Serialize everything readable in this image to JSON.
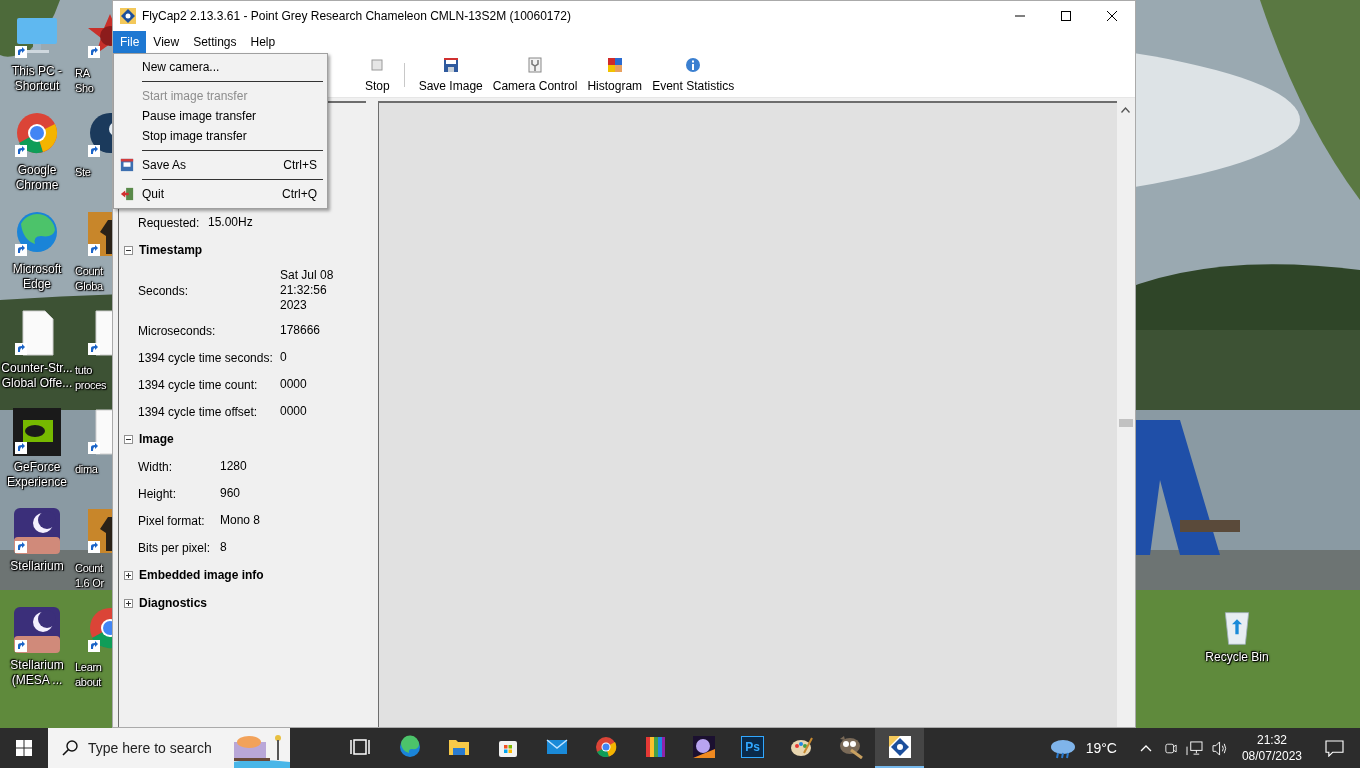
{
  "desktop": {
    "icons": [
      {
        "label": [
          "This PC -",
          "Shortcut"
        ]
      },
      {
        "label": [
          "Google",
          "Chrome"
        ]
      },
      {
        "label": [
          "Microsoft",
          "Edge"
        ]
      },
      {
        "label": [
          "Counter-Str...",
          "Global Offe..."
        ]
      },
      {
        "label": [
          "GeForce",
          "Experience"
        ]
      },
      {
        "label": [
          "Stellarium"
        ]
      },
      {
        "label": [
          "Stellarium",
          "(MESA ..."
        ]
      }
    ],
    "icons_column_2": [
      {
        "label": [
          "RA",
          "Sho"
        ]
      },
      {
        "label": [
          "Ste"
        ]
      },
      {
        "label": [
          "Count",
          "Globa"
        ]
      },
      {
        "label": [
          "tuto",
          "proces"
        ]
      },
      {
        "label": [
          "dima"
        ]
      },
      {
        "label": [
          "Count",
          "1.6 Or"
        ]
      },
      {
        "label": [
          "Learn",
          "about"
        ]
      }
    ],
    "recycle_bin": {
      "label": "Recycle Bin"
    }
  },
  "window": {
    "title": "FlyCap2 2.13.3.61 - Point Grey Research Chameleon CMLN-13S2M (10060172)",
    "menu": [
      {
        "label": "File",
        "selected": true
      },
      {
        "label": "View",
        "selected": false
      },
      {
        "label": "Settings",
        "selected": false
      },
      {
        "label": "Help",
        "selected": false
      }
    ],
    "file_menu": [
      {
        "kind": "item",
        "label": "New camera...",
        "disabled": false
      },
      {
        "kind": "separator"
      },
      {
        "kind": "item",
        "label": "Start image transfer",
        "disabled": true
      },
      {
        "kind": "item",
        "label": "Pause image transfer",
        "disabled": false
      },
      {
        "kind": "item",
        "label": "Stop image transfer",
        "disabled": false
      },
      {
        "kind": "separator"
      },
      {
        "kind": "item",
        "label": "Save As",
        "shortcut": "Ctrl+S",
        "disabled": false
      },
      {
        "kind": "separator"
      },
      {
        "kind": "item",
        "label": "Quit",
        "shortcut": "Ctrl+Q",
        "disabled": false
      }
    ],
    "toolbar": [
      {
        "kind": "button",
        "label": "Stop"
      },
      {
        "kind": "separator"
      },
      {
        "kind": "button",
        "label": "Save Image"
      },
      {
        "kind": "button",
        "label": "Camera Control"
      },
      {
        "kind": "button",
        "label": "Histogram"
      },
      {
        "kind": "button",
        "label": "Event Statistics"
      }
    ],
    "properties": {
      "partial_rows": [
        {
          "label": "Requested:",
          "value": "15.00Hz"
        }
      ],
      "sections": [
        {
          "title": "Timestamp",
          "expanded": true,
          "rows": [
            {
              "label": "Seconds:",
              "value": "Sat Jul 08\n21:32:56\n2023"
            },
            {
              "label": "Microseconds:",
              "value": "178666"
            },
            {
              "label": "1394 cycle time seconds:",
              "value": "0"
            },
            {
              "label": "1394 cycle time count:",
              "value": "0000"
            },
            {
              "label": "1394 cycle time offset:",
              "value": "0000"
            }
          ]
        },
        {
          "title": "Image",
          "expanded": true,
          "rows": [
            {
              "label": "Width:",
              "value": "1280"
            },
            {
              "label": "Height:",
              "value": "960"
            },
            {
              "label": "Pixel format:",
              "value": "Mono 8"
            },
            {
              "label": "Bits per pixel:",
              "value": " 8"
            }
          ]
        },
        {
          "title": "Embedded image info",
          "expanded": false
        },
        {
          "title": "Diagnostics",
          "expanded": false
        }
      ]
    }
  },
  "taskbar": {
    "search": {
      "placeholder": "Type here to search"
    },
    "apps": [
      {
        "selected": false
      },
      {
        "selected": false
      },
      {
        "selected": false
      },
      {
        "selected": false
      },
      {
        "selected": false
      },
      {
        "selected": false
      },
      {
        "selected": false
      },
      {
        "selected": false
      },
      {
        "selected": false,
        "label": "Ps"
      },
      {
        "selected": false
      },
      {
        "selected": false
      },
      {
        "selected": true
      }
    ],
    "weather": "19°C",
    "time": "21:32",
    "date": "08/07/2023"
  }
}
